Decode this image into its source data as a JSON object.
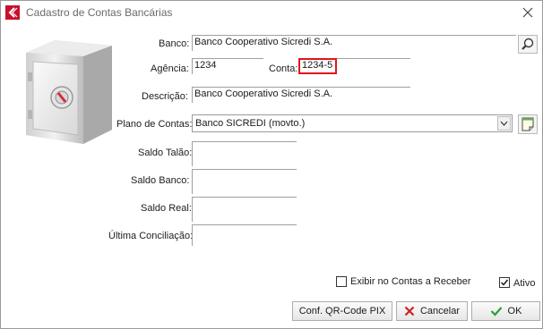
{
  "window": {
    "title": "Cadastro de Contas Bancárias"
  },
  "fields": {
    "banco": {
      "label": "Banco:",
      "value": "Banco Cooperativo Sicredi S.A."
    },
    "agencia": {
      "label": "Agência:",
      "value": "1234"
    },
    "conta": {
      "label": "Conta:",
      "value": "1234-5"
    },
    "descricao": {
      "label": "Descrição:",
      "value": "Banco Cooperativo Sicredi S.A."
    },
    "plano": {
      "label": "Plano de Contas:",
      "value": "Banco SICREDI (movto.)"
    },
    "saldo_talao": {
      "label": "Saldo Talão:",
      "value": ""
    },
    "saldo_banco": {
      "label": "Saldo Banco:",
      "value": ""
    },
    "saldo_real": {
      "label": "Saldo Real:",
      "value": ""
    },
    "ultima_conciliacao": {
      "label": "Última Conciliação:",
      "value": ""
    }
  },
  "options": {
    "exibir_contas_receber": {
      "label": "Exibir no Contas a Receber",
      "checked": false
    },
    "ativo": {
      "label": "Ativo",
      "checked": true
    }
  },
  "buttons": {
    "qr_code": "Conf. QR-Code PIX",
    "cancelar": "Cancelar",
    "ok": "OK"
  },
  "colors": {
    "highlight": "#e0141e",
    "accent_red": "#c8102e",
    "ok_green": "#2e9e2e"
  }
}
